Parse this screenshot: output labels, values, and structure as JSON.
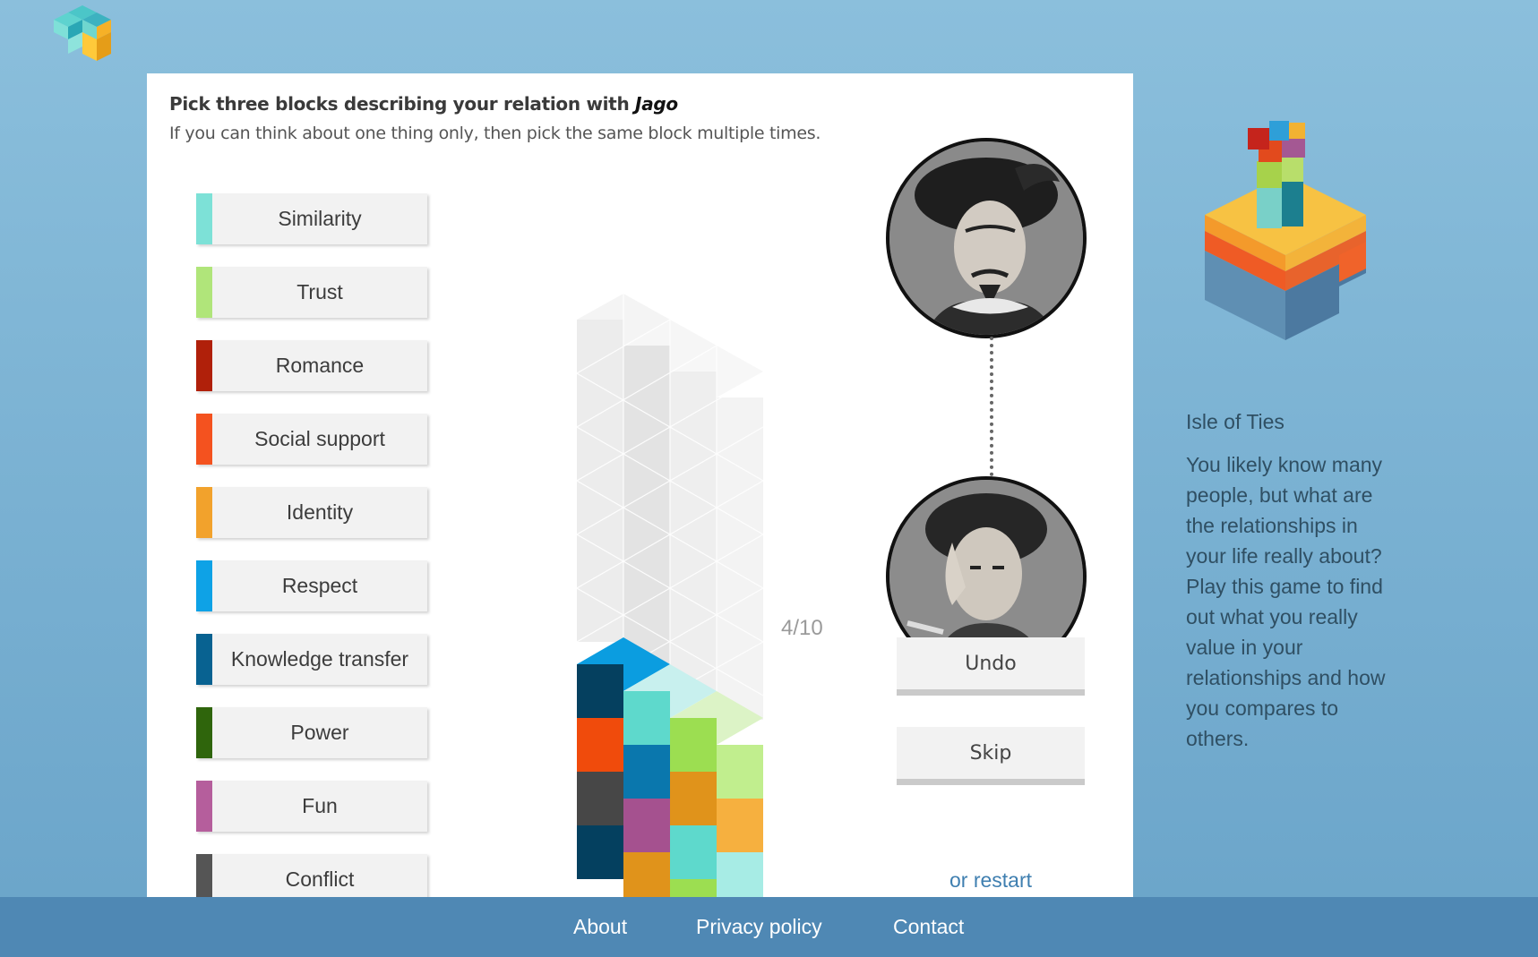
{
  "prompt": {
    "lead": "Pick three blocks describing your relation with ",
    "person": "Jago",
    "sub": "If you can think about one thing only, then pick the same block multiple times."
  },
  "blocks": [
    {
      "label": "Similarity",
      "color": "#7de1d7"
    },
    {
      "label": "Trust",
      "color": "#b0e57a"
    },
    {
      "label": "Romance",
      "color": "#b0200a"
    },
    {
      "label": "Social support",
      "color": "#f4521f"
    },
    {
      "label": "Identity",
      "color": "#f2a22c"
    },
    {
      "label": "Respect",
      "color": "#0ea2e6"
    },
    {
      "label": "Knowledge transfer",
      "color": "#086291"
    },
    {
      "label": "Power",
      "color": "#2f650c"
    },
    {
      "label": "Fun",
      "color": "#b55e9c"
    },
    {
      "label": "Conflict",
      "color": "#555555"
    }
  ],
  "progress": "4/10",
  "actions": {
    "undo": "Undo",
    "skip": "Skip",
    "restart": "or restart"
  },
  "sidebar": {
    "title": "Isle of Ties",
    "text": "You likely know many people, but what are the relationships in your life really about? Play this game to find out what you really value in your relationships and how you compares to others."
  },
  "footer": {
    "about": "About",
    "privacy": "Privacy policy",
    "contact": "Contact"
  }
}
